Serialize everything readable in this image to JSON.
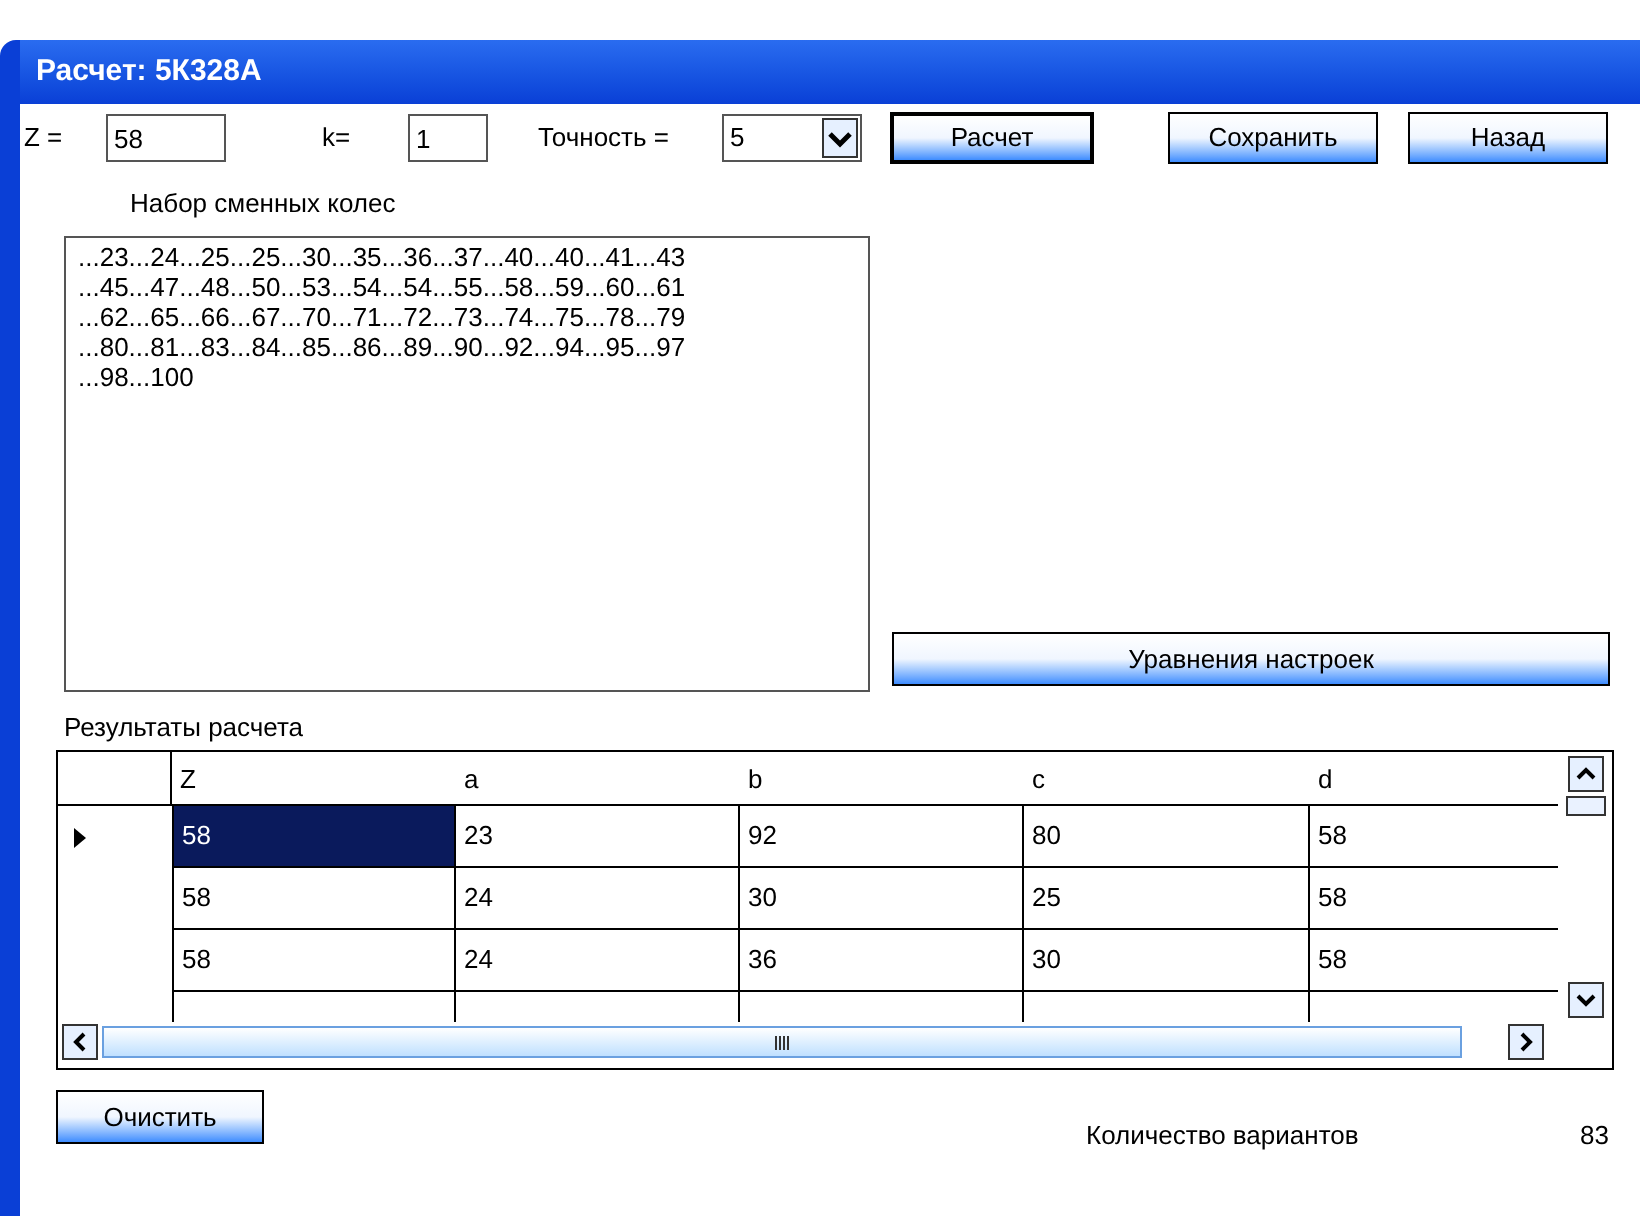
{
  "window": {
    "title": "Расчет: 5К328А"
  },
  "params": [
    {
      "label": "Z =",
      "value": "58"
    },
    {
      "label": "k=",
      "value": "1"
    }
  ],
  "precision": {
    "label": "Точность =",
    "value": "5"
  },
  "buttons": [
    {
      "label": "Расчет",
      "default": true
    },
    {
      "label": "Сохранить",
      "default": false
    },
    {
      "label": "Назад",
      "default": false
    }
  ],
  "gears": {
    "label": "Набор сменных колес",
    "text": "...23...24...25...25...30...35...36...37...40...40...41...43\n...45...47...48...50...53...54...54...55...58...59...60...61\n...62...65...66...67...70...71...72...73...74...75...78...79\n...80...81...83...84...85...86...89...90...92...94...95...97\n...98...100"
  },
  "equations_button": "Уравнения настроек",
  "results": {
    "label": "Результаты расчета",
    "columns": [
      "Z",
      "a",
      "b",
      "c",
      "d"
    ],
    "rows": [
      {
        "selected": true,
        "cells": [
          "58",
          "23",
          "92",
          "80",
          "58"
        ]
      },
      {
        "selected": false,
        "cells": [
          "58",
          "24",
          "30",
          "25",
          "58"
        ]
      },
      {
        "selected": false,
        "cells": [
          "58",
          "24",
          "36",
          "30",
          "58"
        ]
      }
    ]
  },
  "clear_button": "Очистить",
  "count": {
    "label": "Количество вариантов",
    "value": "83"
  }
}
